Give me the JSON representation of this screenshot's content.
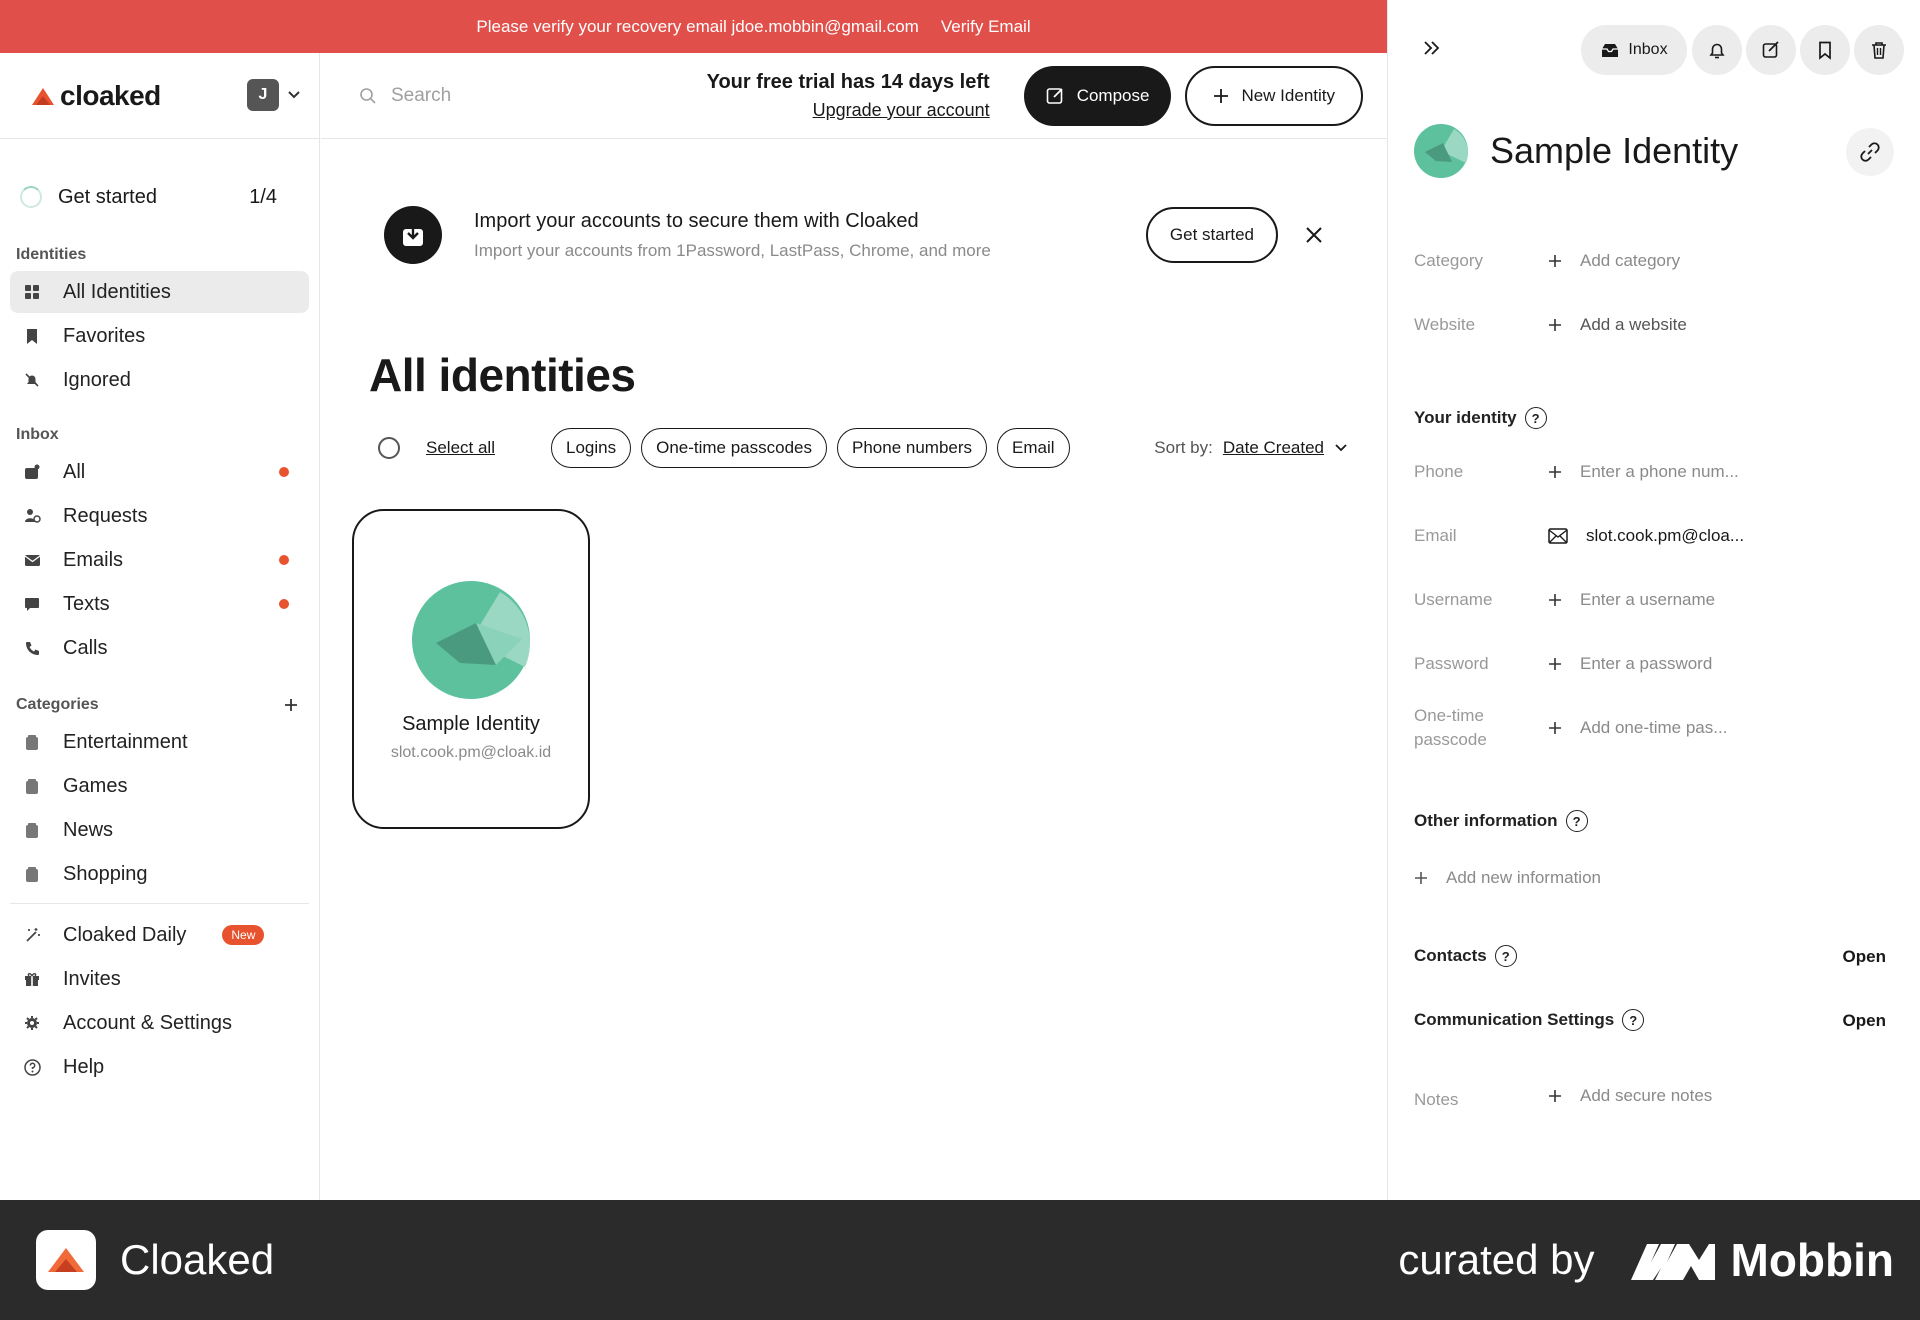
{
  "banner": {
    "message": "Please verify your recovery email jdoe.mobbin@gmail.com",
    "action": "Verify Email"
  },
  "brand": {
    "name": "cloaked",
    "accent": "#e8532f"
  },
  "account": {
    "initial": "J"
  },
  "sidebar": {
    "get_started": {
      "label": "Get started",
      "progress": "1/4"
    },
    "identities_label": "Identities",
    "identities": [
      {
        "label": "All Identities",
        "icon": "grid-icon",
        "active": true
      },
      {
        "label": "Favorites",
        "icon": "bookmark-icon"
      },
      {
        "label": "Ignored",
        "icon": "bell-off-icon"
      }
    ],
    "inbox_label": "Inbox",
    "inbox": [
      {
        "label": "All",
        "icon": "inbox-icon",
        "unread": true
      },
      {
        "label": "Requests",
        "icon": "requests-icon"
      },
      {
        "label": "Emails",
        "icon": "mail-icon",
        "unread": true
      },
      {
        "label": "Texts",
        "icon": "chat-icon",
        "unread": true
      },
      {
        "label": "Calls",
        "icon": "phone-icon"
      }
    ],
    "categories_label": "Categories",
    "categories": [
      {
        "label": "Entertainment"
      },
      {
        "label": "Games"
      },
      {
        "label": "News"
      },
      {
        "label": "Shopping"
      }
    ],
    "bottom": [
      {
        "label": "Cloaked Daily",
        "badge": "New",
        "icon": "sparkle-icon"
      },
      {
        "label": "Invites",
        "icon": "gift-icon"
      },
      {
        "label": "Account & Settings",
        "icon": "gear-icon"
      },
      {
        "label": "Help",
        "icon": "help-icon"
      }
    ]
  },
  "topbar": {
    "search_placeholder": "Search",
    "trial_text": "Your free trial has 14 days left",
    "upgrade_link": "Upgrade your account",
    "compose_label": "Compose",
    "new_identity_label": "New Identity"
  },
  "import_card": {
    "title": "Import your accounts to secure them with Cloaked",
    "subtitle": "Import your accounts from 1Password, LastPass, Chrome, and more",
    "button": "Get started"
  },
  "main": {
    "title": "All identities",
    "select_all": "Select all",
    "filters": [
      "Logins",
      "One-time passcodes",
      "Phone numbers",
      "Email"
    ],
    "sort_label": "Sort by:",
    "sort_value": "Date Created",
    "identity": {
      "name": "Sample Identity",
      "email": "slot.cook.pm@cloak.id"
    }
  },
  "panel": {
    "inbox_label": "Inbox",
    "name": "Sample Identity",
    "category": {
      "label": "Category",
      "value": "Add category"
    },
    "website": {
      "label": "Website",
      "value": "Add a website"
    },
    "your_identity": "Your identity",
    "phone": {
      "label": "Phone",
      "value": "Enter a phone num..."
    },
    "email": {
      "label": "Email",
      "value": "slot.cook.pm@cloa..."
    },
    "username": {
      "label": "Username",
      "value": "Enter a username"
    },
    "password": {
      "label": "Password",
      "value": "Enter a password"
    },
    "otp": {
      "label": "One-time passcode",
      "value": "Add one-time pas..."
    },
    "other_info": "Other information",
    "add_info": "Add new information",
    "contacts": "Contacts",
    "contacts_action": "Open",
    "comm_settings": "Communication Settings",
    "comm_action": "Open",
    "notes": {
      "label": "Notes",
      "value": "Add secure notes"
    }
  },
  "footer": {
    "app_name": "Cloaked",
    "curated": "curated by",
    "brand": "Mobbin"
  }
}
